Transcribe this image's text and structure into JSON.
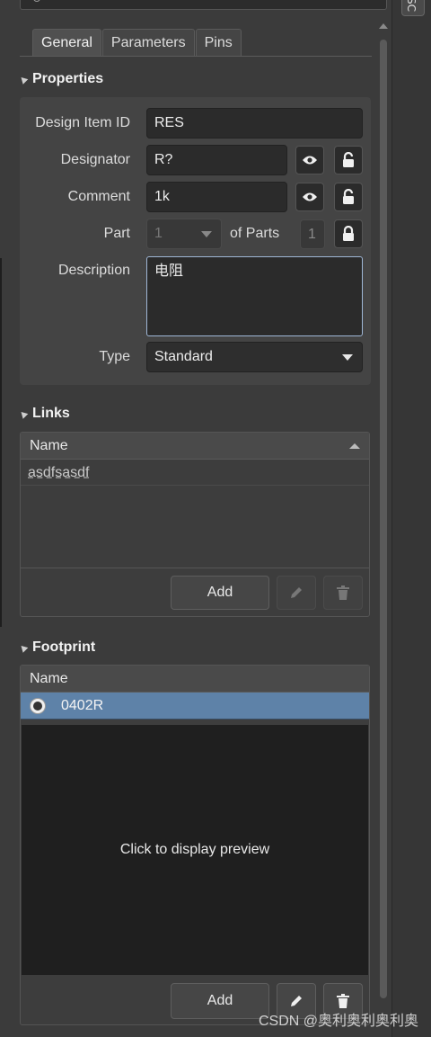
{
  "tabs": [
    "General",
    "Parameters",
    "Pins"
  ],
  "side_tab_label": "SC",
  "properties": {
    "heading": "Properties",
    "design_item_id": {
      "label": "Design Item ID",
      "value": "RES"
    },
    "designator": {
      "label": "Designator",
      "value": "R?"
    },
    "comment": {
      "label": "Comment",
      "value": "1k"
    },
    "part": {
      "label": "Part",
      "value": "1",
      "of_parts_label": "of Parts",
      "of_parts_value": "1"
    },
    "description": {
      "label": "Description",
      "value": "电阻"
    },
    "type": {
      "label": "Type",
      "value": "Standard"
    }
  },
  "links": {
    "heading": "Links",
    "column": "Name",
    "rows": [
      "asdfsasdf"
    ],
    "add_label": "Add"
  },
  "footprint": {
    "heading": "Footprint",
    "column": "Name",
    "rows": [
      "0402R"
    ],
    "preview_text": "Click to display preview",
    "add_label": "Add"
  },
  "watermark": "CSDN @奥利奥利奥利奥",
  "colors": {
    "panel_bg": "#3b3b3b",
    "field_bg": "#2b2b2b",
    "selected_row": "#5e82a8",
    "preview_bg": "#1f1f1f"
  }
}
